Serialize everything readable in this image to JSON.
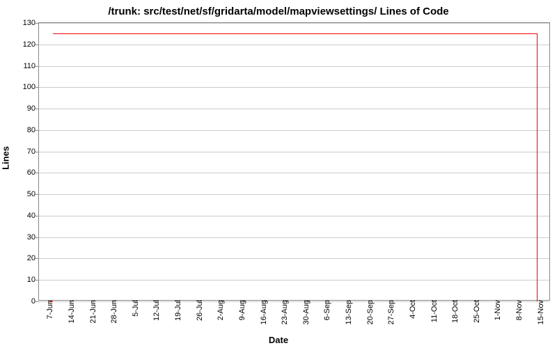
{
  "chart_data": {
    "type": "line",
    "title": "/trunk: src/test/net/sf/gridarta/model/mapviewsettings/ Lines of Code",
    "xlabel": "Date",
    "ylabel": "Lines",
    "ylim": [
      0,
      130
    ],
    "yticks": [
      0,
      10,
      20,
      30,
      40,
      50,
      60,
      70,
      80,
      90,
      100,
      110,
      120,
      130
    ],
    "xticks": [
      "7-Jun",
      "14-Jun",
      "21-Jun",
      "28-Jun",
      "5-Jul",
      "12-Jul",
      "19-Jul",
      "26-Jul",
      "2-Aug",
      "9-Aug",
      "16-Aug",
      "23-Aug",
      "30-Aug",
      "6-Sep",
      "13-Sep",
      "20-Sep",
      "27-Sep",
      "4-Oct",
      "11-Oct",
      "18-Oct",
      "25-Oct",
      "1-Nov",
      "8-Nov",
      "15-Nov"
    ],
    "series": [
      {
        "name": "Lines of Code",
        "color": "#e00000",
        "points": [
          {
            "x": "7-Jun",
            "y": 0
          },
          {
            "x": "8-Jun",
            "y": 125
          },
          {
            "x": "14-Nov",
            "y": 125
          },
          {
            "x": "14-Nov",
            "y": 0
          }
        ]
      }
    ]
  }
}
